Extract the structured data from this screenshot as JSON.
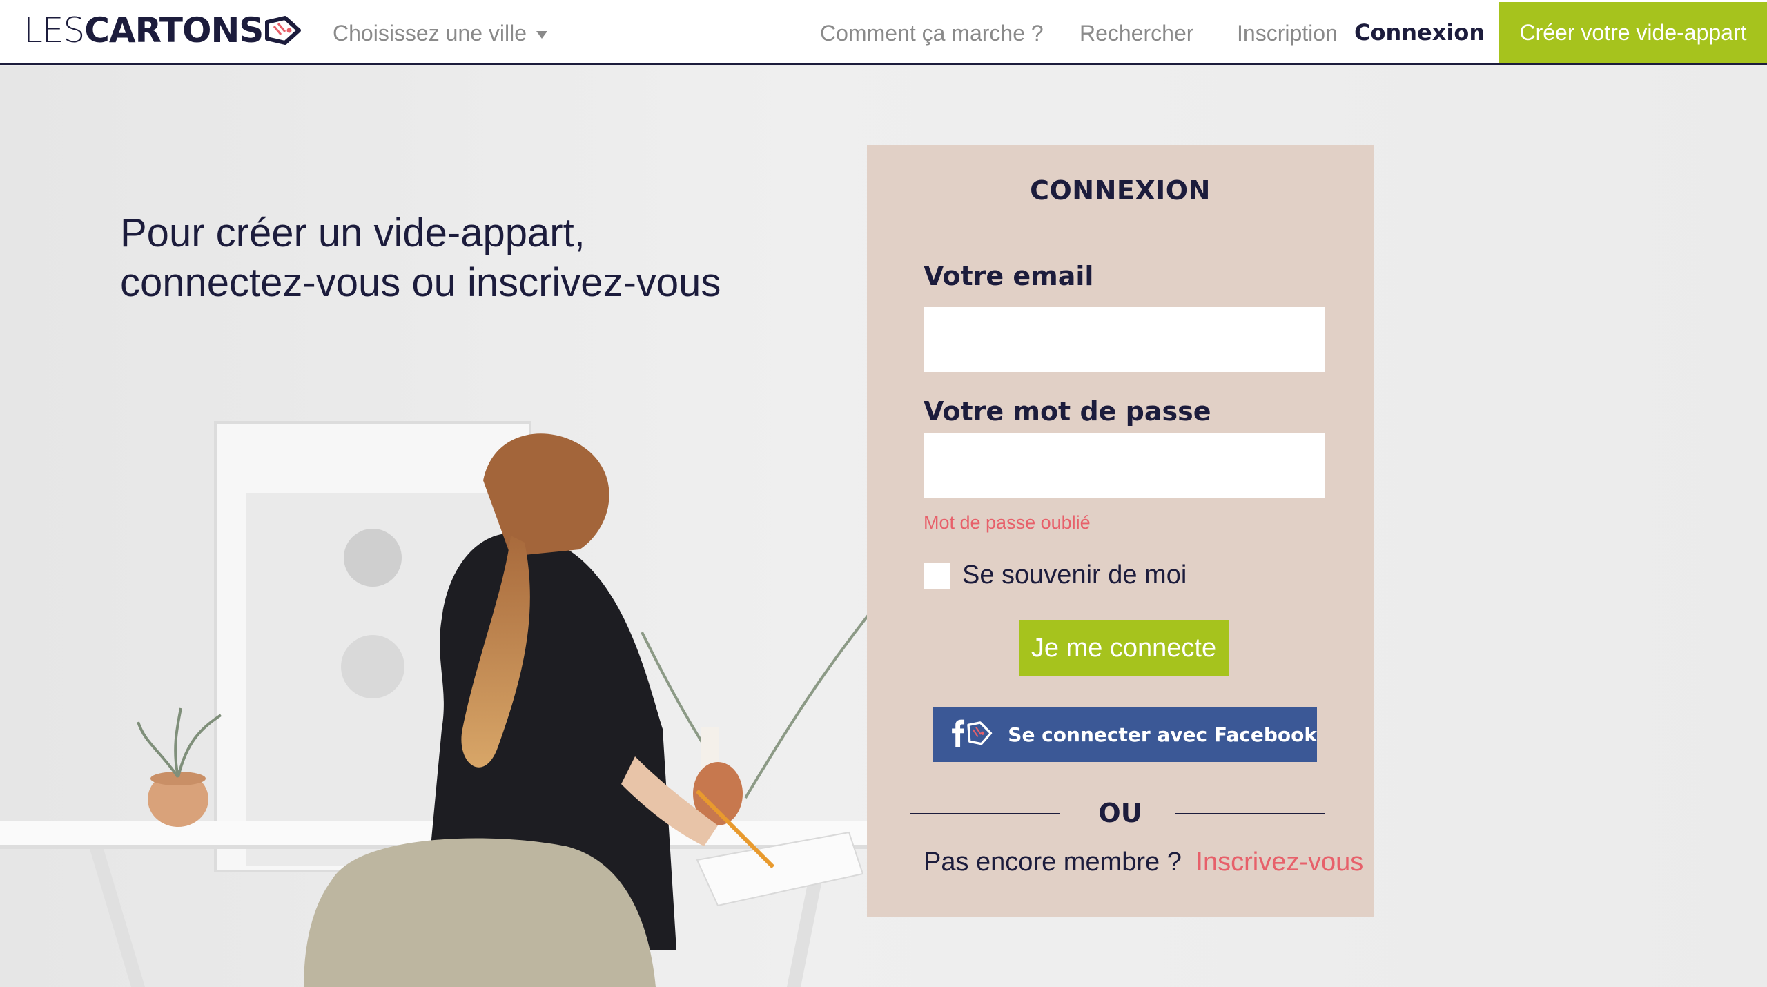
{
  "header": {
    "logo_light": "LES",
    "logo_bold": "CARTONS",
    "city_select": "Choisissez une ville",
    "nav": {
      "comment": "Comment ça marche ?",
      "rechercher": "Rechercher",
      "inscription": "Inscription",
      "connexion": "Connexion",
      "cta": "Créer votre vide-appart"
    }
  },
  "hero": {
    "headline_line1": "Pour créer un vide-appart,",
    "headline_line2": "connectez-vous ou inscrivez-vous"
  },
  "login": {
    "title": "CONNEXION",
    "email_label": "Votre email",
    "email_value": "",
    "password_label": "Votre mot de passe",
    "password_value": "",
    "forgot": "Mot de passe oublié",
    "remember": "Se souvenir de moi",
    "remember_checked": false,
    "submit": "Je me connecte",
    "facebook": "Se connecter avec Facebook",
    "divider": "OU",
    "signup_prompt": "Pas encore membre ?",
    "signup_link": "Inscrivez-vous"
  },
  "colors": {
    "navy": "#1c1c3c",
    "lime": "#a6c31d",
    "coral": "#e7606a",
    "card": "#e1d0c6",
    "facebook": "#3b5896"
  }
}
